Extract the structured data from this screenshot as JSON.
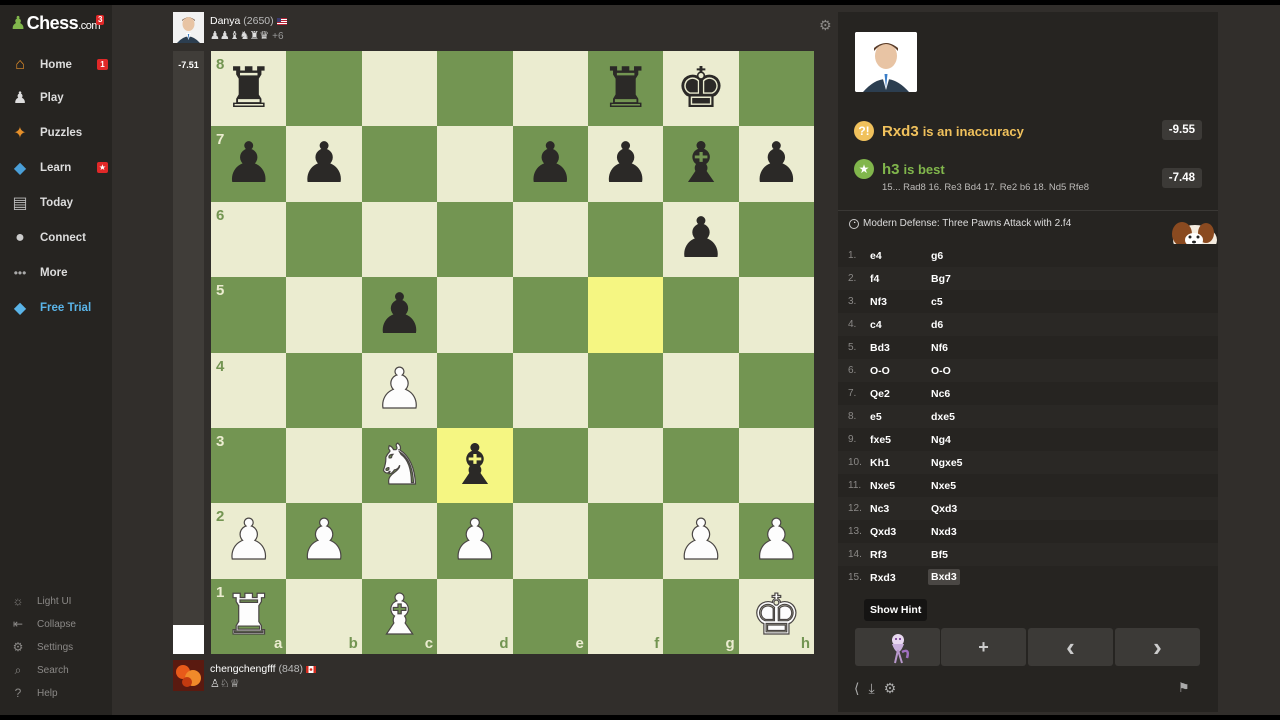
{
  "site": {
    "logo": "Chess",
    "logo_suffix": ".com",
    "logo_badge": "3"
  },
  "nav": [
    {
      "label": "Home",
      "icon": "home-icon",
      "badge": "1"
    },
    {
      "label": "Play",
      "icon": "play-icon"
    },
    {
      "label": "Puzzles",
      "icon": "puzzle-icon"
    },
    {
      "label": "Learn",
      "icon": "learn-icon",
      "badge": "★"
    },
    {
      "label": "Today",
      "icon": "news-icon"
    },
    {
      "label": "Connect",
      "icon": "chat-icon"
    },
    {
      "label": "More",
      "icon": "dots-icon"
    },
    {
      "label": "Free Trial",
      "icon": "diamond-icon"
    }
  ],
  "bottom_nav": [
    {
      "label": "Light UI",
      "icon": "sun-icon"
    },
    {
      "label": "Collapse",
      "icon": "collapse-icon"
    },
    {
      "label": "Settings",
      "icon": "gear-icon"
    },
    {
      "label": "Search",
      "icon": "search-icon"
    },
    {
      "label": "Help",
      "icon": "help-icon"
    }
  ],
  "top_player": {
    "name": "Danya",
    "rating": "(2650)",
    "captured": "♟♟♝♞♜♛",
    "advantage": "+6",
    "flag": "US"
  },
  "bottom_player": {
    "name": "chengchengfff",
    "rating": "(848)",
    "captured": "♙♘♕",
    "flag": "CA"
  },
  "eval": {
    "value": "-7.51",
    "white_fraction": 0.05
  },
  "board": {
    "files": [
      "a",
      "b",
      "c",
      "d",
      "e",
      "f",
      "g",
      "h"
    ],
    "ranks": [
      "8",
      "7",
      "6",
      "5",
      "4",
      "3",
      "2",
      "1"
    ],
    "highlight": [
      "f5",
      "d3"
    ],
    "pieces": {
      "a8": "br",
      "f8": "br",
      "g8": "bk",
      "a7": "bp",
      "b7": "bp",
      "e7": "bp",
      "f7": "bp",
      "g7": "bb",
      "h7": "bp",
      "g6": "bp",
      "c5": "bp",
      "c4": "wp",
      "c3": "wn",
      "d3": "bb",
      "a2": "wp",
      "b2": "wp",
      "d2": "wp",
      "g2": "wp",
      "h2": "wp",
      "a1": "wr",
      "c1": "wb",
      "h1": "wk"
    }
  },
  "analysis": {
    "mistake": {
      "move": "Rxd3",
      "text": "is an inaccuracy",
      "score": "-9.55",
      "icon_text": "?!"
    },
    "best": {
      "move": "h3",
      "text": "is best",
      "score": "-7.48",
      "line": "15... Rad8 16. Re3 Bd4 17. Re2 b6 18. Nd5 Rfe8"
    },
    "opening": "Modern Defense: Three Pawns Attack with 2.f4"
  },
  "moves": [
    {
      "n": "1.",
      "w": "e4",
      "b": "g6"
    },
    {
      "n": "2.",
      "w": "f4",
      "b": "Bg7"
    },
    {
      "n": "3.",
      "w": "Nf3",
      "b": "c5"
    },
    {
      "n": "4.",
      "w": "c4",
      "b": "d6"
    },
    {
      "n": "5.",
      "w": "Bd3",
      "b": "Nf6"
    },
    {
      "n": "6.",
      "w": "O-O",
      "b": "O-O"
    },
    {
      "n": "7.",
      "w": "Qe2",
      "b": "Nc6"
    },
    {
      "n": "8.",
      "w": "e5",
      "b": "dxe5"
    },
    {
      "n": "9.",
      "w": "fxe5",
      "b": "Ng4"
    },
    {
      "n": "10.",
      "w": "Kh1",
      "b": "Ngxe5"
    },
    {
      "n": "11.",
      "w": "Nxe5",
      "b": "Nxe5"
    },
    {
      "n": "12.",
      "w": "Nc3",
      "b": "Qxd3"
    },
    {
      "n": "13.",
      "w": "Qxd3",
      "b": "Nxd3"
    },
    {
      "n": "14.",
      "w": "Rf3",
      "b": "Bf5"
    },
    {
      "n": "15.",
      "w": "Rxd3",
      "b": "Bxd3"
    }
  ],
  "current_move_index": 14,
  "controls": {
    "tooltip": "Show Hint",
    "add": "+",
    "prev": "‹",
    "next": "›"
  },
  "colors": {
    "board_light": "#ebecd0",
    "board_dark": "#739552",
    "highlight": "#f5f682",
    "inaccuracy": "#f0c15c",
    "best": "#81b64c"
  }
}
